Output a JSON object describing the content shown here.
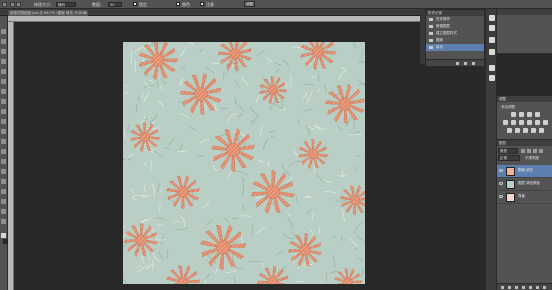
{
  "options_bar": {
    "brush_size_label": "修改大小：",
    "mode_value": "随机",
    "value_label": "数值：",
    "value_field": "30",
    "checkbox1_label": "锁定",
    "checkbox2_label": "颜色",
    "checkbox3_label": "注意",
    "button_label": "调整"
  },
  "document_tab": {
    "title": "欧锦花园贴图.psd @ 66.7% (图案 填充, RGB/8)",
    "close": "×"
  },
  "history": {
    "title": "历史记录",
    "items": [
      {
        "label": "历史操作"
      },
      {
        "label": "新建图层"
      },
      {
        "label": "建立图层样式"
      },
      {
        "label": "图案"
      },
      {
        "label": "填充"
      }
    ],
    "selected_index": 4
  },
  "adjustments": {
    "tab_label": "调整",
    "subtitle": "添加调整"
  },
  "layers": {
    "tab_label": "图层",
    "kind_label": "类型",
    "blend_mode": "正常",
    "opacity_label": "不透明度",
    "items": [
      {
        "name": "图案 填充",
        "thumb": "#f0b39a",
        "selected": true
      },
      {
        "name": "图层 填充颜色",
        "thumb": "#b7d0c6",
        "selected": false
      },
      {
        "name": "背景",
        "thumb": "#f3d7ce",
        "selected": false
      }
    ]
  },
  "colors": {
    "background_tile": "#b9cec4",
    "flower": "#e28b6b",
    "stroke": "#eef3ee",
    "selection": "#5d7faf"
  }
}
